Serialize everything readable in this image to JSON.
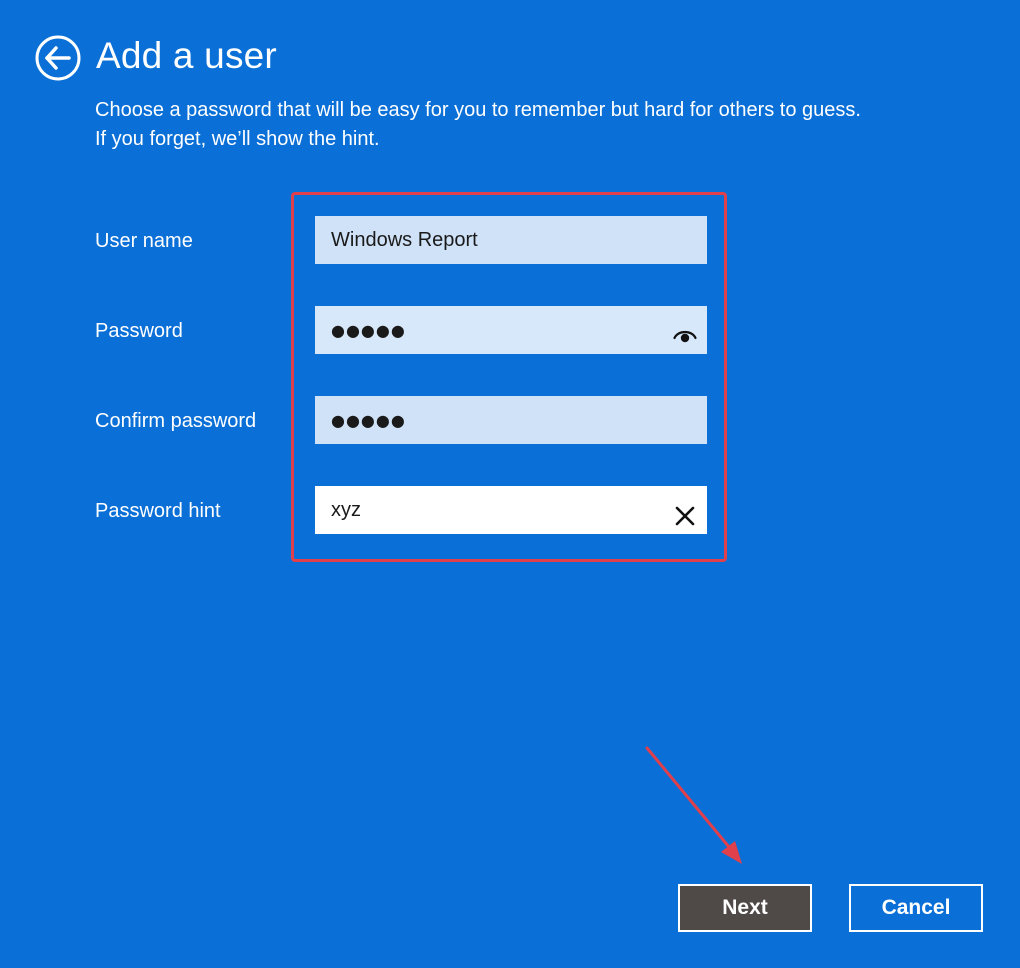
{
  "header": {
    "title": "Add a user",
    "subtitle_line1": "Choose a password that will be easy for you to remember but hard for others to guess.",
    "subtitle_line2": "If you forget, we’ll show the hint."
  },
  "form": {
    "username": {
      "label": "User name",
      "value": "Windows Report"
    },
    "password": {
      "label": "Password",
      "value": "●●●●●"
    },
    "confirm_password": {
      "label": "Confirm password",
      "value": "●●●●●"
    },
    "password_hint": {
      "label": "Password hint",
      "value": "xyz"
    }
  },
  "buttons": {
    "next_label": "Next",
    "cancel_label": "Cancel"
  },
  "icons": {
    "back": "back-arrow-icon",
    "reveal": "eye-icon",
    "clear": "close-icon"
  },
  "colors": {
    "background": "#0a6fd6",
    "annotation": "#e0404c",
    "next_button": "#4f4a48"
  }
}
